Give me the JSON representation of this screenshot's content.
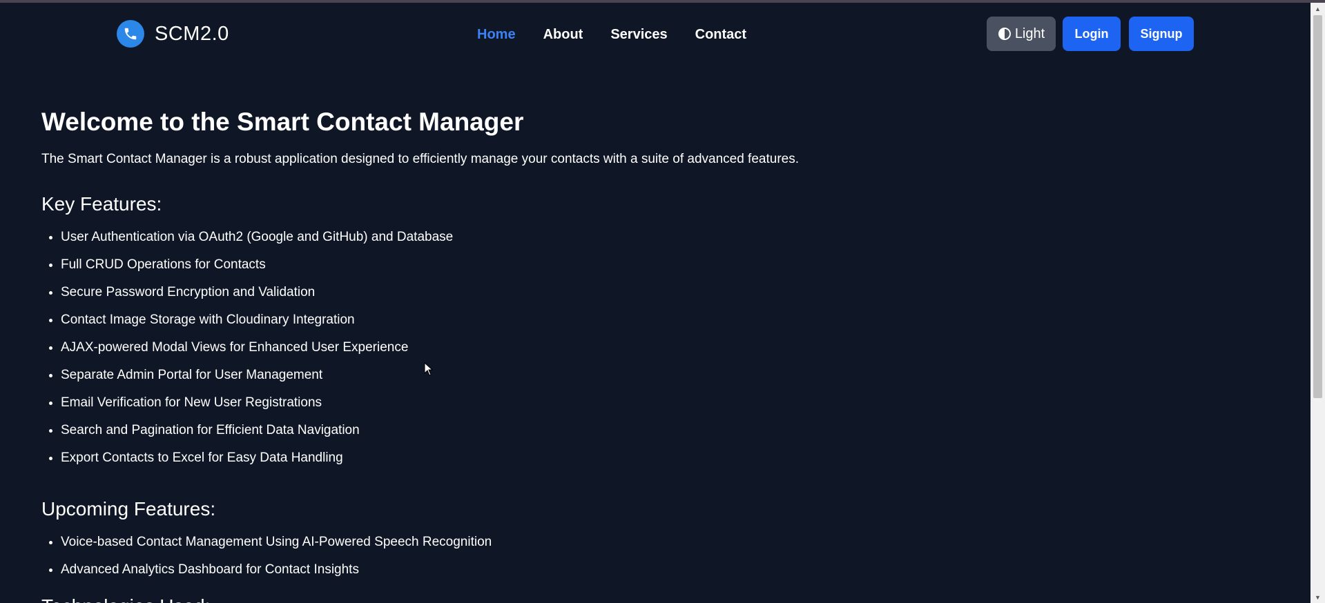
{
  "brand": {
    "name": "SCM2.0",
    "icon": "phone-icon"
  },
  "nav": {
    "links": [
      {
        "label": "Home",
        "active": true
      },
      {
        "label": "About",
        "active": false
      },
      {
        "label": "Services",
        "active": false
      },
      {
        "label": "Contact",
        "active": false
      }
    ],
    "theme_label": "Light",
    "login_label": "Login",
    "signup_label": "Signup"
  },
  "main": {
    "title": "Welcome to the Smart Contact Manager",
    "intro": "The Smart Contact Manager is a robust application designed to efficiently manage your contacts with a suite of advanced features.",
    "key_features_heading": "Key Features:",
    "key_features": [
      "User Authentication via OAuth2 (Google and GitHub) and Database",
      "Full CRUD Operations for Contacts",
      "Secure Password Encryption and Validation",
      "Contact Image Storage with Cloudinary Integration",
      "AJAX-powered Modal Views for Enhanced User Experience",
      "Separate Admin Portal for User Management",
      "Email Verification for New User Registrations",
      "Search and Pagination for Efficient Data Navigation",
      "Export Contacts to Excel for Easy Data Handling"
    ],
    "upcoming_heading": "Upcoming Features:",
    "upcoming_features": [
      "Voice-based Contact Management Using AI-Powered Speech Recognition",
      "Advanced Analytics Dashboard for Contact Insights"
    ],
    "next_heading_partial": "Technologies Used:"
  },
  "colors": {
    "background": "#0f1626",
    "accent": "#1d64f2",
    "active_link": "#3b82f6",
    "theme_button": "#4a5262"
  }
}
